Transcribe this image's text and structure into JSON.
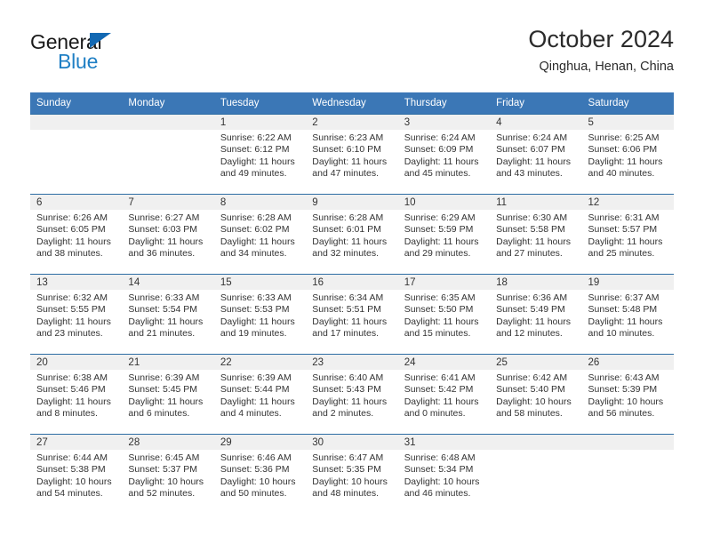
{
  "brand": {
    "name_part1": "General",
    "name_part2": "Blue",
    "logo_icon": "triangle-icon",
    "accent_color": "#1f7fc4"
  },
  "header": {
    "title": "October 2024",
    "location": "Qinghua, Henan, China"
  },
  "colors": {
    "header_blue": "#3b77b6",
    "row_divider_blue": "#2e6da4",
    "date_band_gray": "#f0f0f0",
    "text": "#333333"
  },
  "calendar": {
    "weekdays": [
      "Sunday",
      "Monday",
      "Tuesday",
      "Wednesday",
      "Thursday",
      "Friday",
      "Saturday"
    ],
    "labels": {
      "sunrise": "Sunrise:",
      "sunset": "Sunset:",
      "daylight": "Daylight:"
    },
    "weeks": [
      [
        {
          "date": "",
          "empty": true
        },
        {
          "date": "",
          "empty": true
        },
        {
          "date": "1",
          "sunrise": "Sunrise: 6:22 AM",
          "sunset": "Sunset: 6:12 PM",
          "daylight": "Daylight: 11 hours and 49 minutes."
        },
        {
          "date": "2",
          "sunrise": "Sunrise: 6:23 AM",
          "sunset": "Sunset: 6:10 PM",
          "daylight": "Daylight: 11 hours and 47 minutes."
        },
        {
          "date": "3",
          "sunrise": "Sunrise: 6:24 AM",
          "sunset": "Sunset: 6:09 PM",
          "daylight": "Daylight: 11 hours and 45 minutes."
        },
        {
          "date": "4",
          "sunrise": "Sunrise: 6:24 AM",
          "sunset": "Sunset: 6:07 PM",
          "daylight": "Daylight: 11 hours and 43 minutes."
        },
        {
          "date": "5",
          "sunrise": "Sunrise: 6:25 AM",
          "sunset": "Sunset: 6:06 PM",
          "daylight": "Daylight: 11 hours and 40 minutes."
        }
      ],
      [
        {
          "date": "6",
          "sunrise": "Sunrise: 6:26 AM",
          "sunset": "Sunset: 6:05 PM",
          "daylight": "Daylight: 11 hours and 38 minutes."
        },
        {
          "date": "7",
          "sunrise": "Sunrise: 6:27 AM",
          "sunset": "Sunset: 6:03 PM",
          "daylight": "Daylight: 11 hours and 36 minutes."
        },
        {
          "date": "8",
          "sunrise": "Sunrise: 6:28 AM",
          "sunset": "Sunset: 6:02 PM",
          "daylight": "Daylight: 11 hours and 34 minutes."
        },
        {
          "date": "9",
          "sunrise": "Sunrise: 6:28 AM",
          "sunset": "Sunset: 6:01 PM",
          "daylight": "Daylight: 11 hours and 32 minutes."
        },
        {
          "date": "10",
          "sunrise": "Sunrise: 6:29 AM",
          "sunset": "Sunset: 5:59 PM",
          "daylight": "Daylight: 11 hours and 29 minutes."
        },
        {
          "date": "11",
          "sunrise": "Sunrise: 6:30 AM",
          "sunset": "Sunset: 5:58 PM",
          "daylight": "Daylight: 11 hours and 27 minutes."
        },
        {
          "date": "12",
          "sunrise": "Sunrise: 6:31 AM",
          "sunset": "Sunset: 5:57 PM",
          "daylight": "Daylight: 11 hours and 25 minutes."
        }
      ],
      [
        {
          "date": "13",
          "sunrise": "Sunrise: 6:32 AM",
          "sunset": "Sunset: 5:55 PM",
          "daylight": "Daylight: 11 hours and 23 minutes."
        },
        {
          "date": "14",
          "sunrise": "Sunrise: 6:33 AM",
          "sunset": "Sunset: 5:54 PM",
          "daylight": "Daylight: 11 hours and 21 minutes."
        },
        {
          "date": "15",
          "sunrise": "Sunrise: 6:33 AM",
          "sunset": "Sunset: 5:53 PM",
          "daylight": "Daylight: 11 hours and 19 minutes."
        },
        {
          "date": "16",
          "sunrise": "Sunrise: 6:34 AM",
          "sunset": "Sunset: 5:51 PM",
          "daylight": "Daylight: 11 hours and 17 minutes."
        },
        {
          "date": "17",
          "sunrise": "Sunrise: 6:35 AM",
          "sunset": "Sunset: 5:50 PM",
          "daylight": "Daylight: 11 hours and 15 minutes."
        },
        {
          "date": "18",
          "sunrise": "Sunrise: 6:36 AM",
          "sunset": "Sunset: 5:49 PM",
          "daylight": "Daylight: 11 hours and 12 minutes."
        },
        {
          "date": "19",
          "sunrise": "Sunrise: 6:37 AM",
          "sunset": "Sunset: 5:48 PM",
          "daylight": "Daylight: 11 hours and 10 minutes."
        }
      ],
      [
        {
          "date": "20",
          "sunrise": "Sunrise: 6:38 AM",
          "sunset": "Sunset: 5:46 PM",
          "daylight": "Daylight: 11 hours and 8 minutes."
        },
        {
          "date": "21",
          "sunrise": "Sunrise: 6:39 AM",
          "sunset": "Sunset: 5:45 PM",
          "daylight": "Daylight: 11 hours and 6 minutes."
        },
        {
          "date": "22",
          "sunrise": "Sunrise: 6:39 AM",
          "sunset": "Sunset: 5:44 PM",
          "daylight": "Daylight: 11 hours and 4 minutes."
        },
        {
          "date": "23",
          "sunrise": "Sunrise: 6:40 AM",
          "sunset": "Sunset: 5:43 PM",
          "daylight": "Daylight: 11 hours and 2 minutes."
        },
        {
          "date": "24",
          "sunrise": "Sunrise: 6:41 AM",
          "sunset": "Sunset: 5:42 PM",
          "daylight": "Daylight: 11 hours and 0 minutes."
        },
        {
          "date": "25",
          "sunrise": "Sunrise: 6:42 AM",
          "sunset": "Sunset: 5:40 PM",
          "daylight": "Daylight: 10 hours and 58 minutes."
        },
        {
          "date": "26",
          "sunrise": "Sunrise: 6:43 AM",
          "sunset": "Sunset: 5:39 PM",
          "daylight": "Daylight: 10 hours and 56 minutes."
        }
      ],
      [
        {
          "date": "27",
          "sunrise": "Sunrise: 6:44 AM",
          "sunset": "Sunset: 5:38 PM",
          "daylight": "Daylight: 10 hours and 54 minutes."
        },
        {
          "date": "28",
          "sunrise": "Sunrise: 6:45 AM",
          "sunset": "Sunset: 5:37 PM",
          "daylight": "Daylight: 10 hours and 52 minutes."
        },
        {
          "date": "29",
          "sunrise": "Sunrise: 6:46 AM",
          "sunset": "Sunset: 5:36 PM",
          "daylight": "Daylight: 10 hours and 50 minutes."
        },
        {
          "date": "30",
          "sunrise": "Sunrise: 6:47 AM",
          "sunset": "Sunset: 5:35 PM",
          "daylight": "Daylight: 10 hours and 48 minutes."
        },
        {
          "date": "31",
          "sunrise": "Sunrise: 6:48 AM",
          "sunset": "Sunset: 5:34 PM",
          "daylight": "Daylight: 10 hours and 46 minutes."
        },
        {
          "date": "",
          "empty": true
        },
        {
          "date": "",
          "empty": true
        }
      ]
    ]
  }
}
